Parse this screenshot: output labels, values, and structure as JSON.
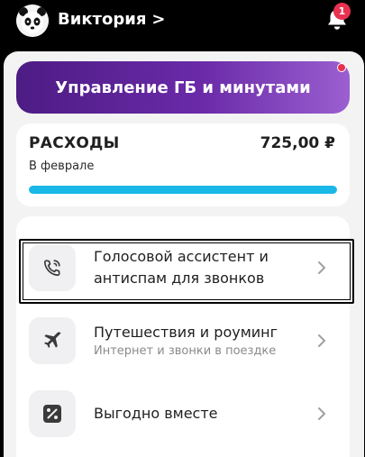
{
  "header": {
    "user_name": "Виктория",
    "user_chevron": ">",
    "notification_count": "1"
  },
  "promo": {
    "label": "Управление ГБ и минутами"
  },
  "expenses": {
    "title": "РАСХОДЫ",
    "amount": "725,00 ₽",
    "period": "В феврале",
    "progress_fraction": 1.0
  },
  "services": [
    {
      "title_line1": "Голосовой ассистент и",
      "title_line2": "антиспам для звонков",
      "subtitle": "",
      "icon": "phone-assistant-icon"
    },
    {
      "title_line1": "Путешествия и роуминг",
      "title_line2": "",
      "subtitle": "Интернет и звонки в поездке",
      "icon": "airplane-icon"
    },
    {
      "title_line1": "Выгодно вместе",
      "title_line2": "",
      "subtitle": "",
      "icon": "percent-tag-icon"
    }
  ],
  "colors": {
    "accent_purple": "#6a2aa8",
    "badge_red": "#e8324f",
    "progress_blue": "#19b8e6"
  }
}
